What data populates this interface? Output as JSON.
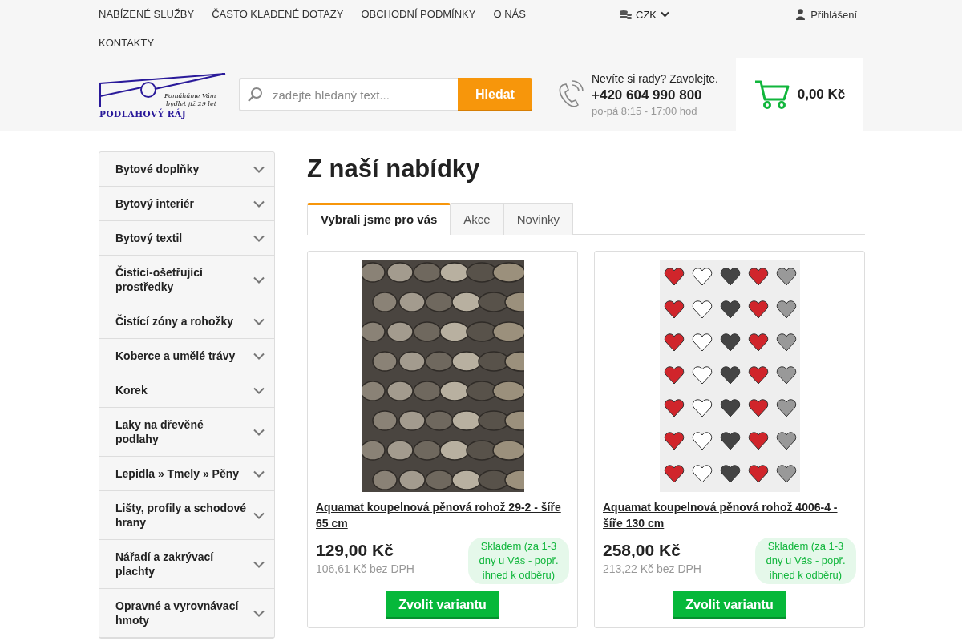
{
  "top_nav": {
    "links": [
      "NABÍZENÉ SLUŽBY",
      "ČASTO KLADENÉ DOTAZY",
      "OBCHODNÍ PODMÍNKY",
      "O NÁS",
      "KONTAKTY"
    ],
    "currency": "CZK",
    "login": "Přihlášení"
  },
  "header": {
    "logo": {
      "tagline_1": "Pomáháme Vám",
      "tagline_2": "bydlet již 29 let",
      "name": "PODLAHOVÝ RÁJ"
    },
    "search": {
      "placeholder": "zadejte hledaný text...",
      "button": "Hledat"
    },
    "contact": {
      "question": "Nevíte si rady? Zavolejte.",
      "phone": "+420 604 990 800",
      "hours": "po-pá 8:15 - 17:00 hod"
    },
    "cart": {
      "total": "0,00 Kč"
    }
  },
  "sidebar": {
    "items": [
      {
        "label": "Bytové doplňky",
        "expanded": false
      },
      {
        "label": "Bytový interiér",
        "expanded": false
      },
      {
        "label": "Bytový textil",
        "expanded": false
      },
      {
        "label": "Čistící-ošetřující prostředky",
        "expanded": false
      },
      {
        "label": "Čistící zóny a rohožky",
        "expanded": false
      },
      {
        "label": "Koberce a umělé trávy",
        "expanded": false
      },
      {
        "label": "Korek",
        "expanded": false
      },
      {
        "label": "Laky na dřevěné podlahy",
        "expanded": false
      },
      {
        "label": "Lepidla » Tmely » Pěny",
        "expanded": false
      },
      {
        "label": "Lišty, profily a schodové hrany",
        "expanded": false
      },
      {
        "label": "Nářadí a zakrývací plachty",
        "expanded": false
      },
      {
        "label": "Opravné a vyrovnávací hmoty",
        "expanded": false
      }
    ]
  },
  "main": {
    "heading": "Z naší nabídky",
    "tabs": [
      {
        "label": "Vybrali jsme pro vás",
        "selected": true
      },
      {
        "label": "Akce",
        "selected": false
      },
      {
        "label": "Novinky",
        "selected": false
      }
    ],
    "products": [
      {
        "kind": "stones",
        "name": "Aquamat koupelnová pěnová rohož 29-2 - šíře 65 cm",
        "price": "129,00 Kč",
        "price_net": "106,61 Kč bez DPH",
        "availability": "Skladem (za 1-3 dny u Vás - popř. ihned k odběru)",
        "button": "Zvolit variantu"
      },
      {
        "kind": "hearts",
        "name": "Aquamat koupelnová pěnová rohož 4006-4 - šíře 130 cm",
        "price": "258,00 Kč",
        "price_net": "213,22 Kč bez DPH",
        "availability": "Skladem (za 1-3 dny u Vás - popř. ihned k odběru)",
        "button": "Zvolit variantu"
      }
    ]
  }
}
